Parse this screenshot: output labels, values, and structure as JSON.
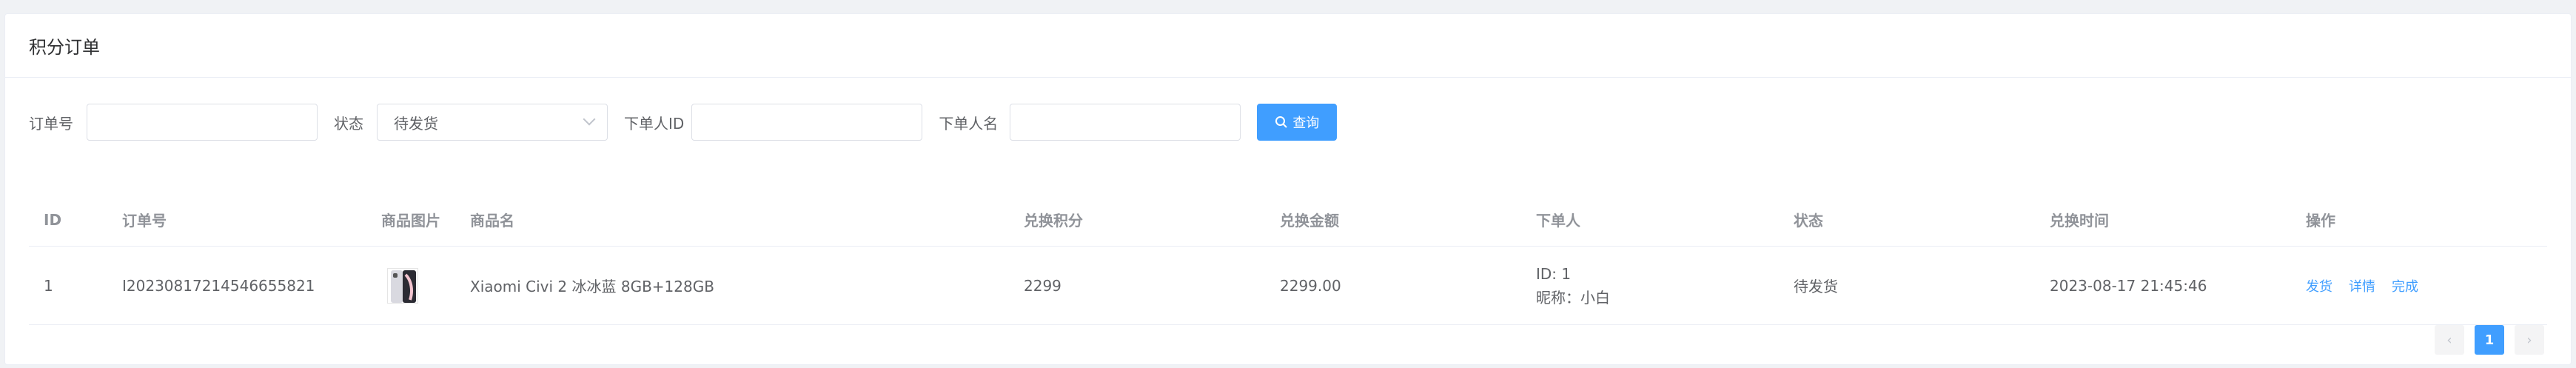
{
  "card": {
    "title": "积分订单"
  },
  "filters": {
    "order_no_label": "订单号",
    "order_no_value": "",
    "status_label": "状态",
    "status_value": "待发货",
    "user_id_label": "下单人ID",
    "user_id_value": "",
    "user_name_label": "下单人名",
    "user_name_value": "",
    "query_button": "查询"
  },
  "table": {
    "headers": [
      "ID",
      "订单号",
      "商品图片",
      "商品名",
      "兑换积分",
      "兑换金额",
      "下单人",
      "状态",
      "兑换时间",
      "操作"
    ],
    "rows": [
      {
        "id": "1",
        "order_no": "I20230817214546655821",
        "product_name": "Xiaomi Civi 2 冰冰蓝 8GB+128GB",
        "points": "2299",
        "amount": "2299.00",
        "user_id_line": "ID: 1",
        "user_nick_line": "昵称：小白",
        "status": "待发货",
        "time": "2023-08-17 21:45:46",
        "actions": [
          "发货",
          "详情",
          "完成"
        ]
      }
    ]
  },
  "pagination": {
    "prev": "‹",
    "current": "1",
    "next": "›"
  },
  "colors": {
    "primary": "#409eff",
    "border": "#dcdfe6",
    "header_text": "#909399"
  }
}
